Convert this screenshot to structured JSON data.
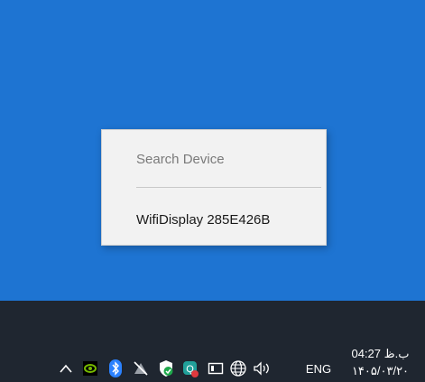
{
  "context_menu": {
    "items": [
      {
        "label": "Search Device",
        "enabled": false
      },
      {
        "label": "WifiDisplay 285E426B",
        "enabled": true
      }
    ]
  },
  "taskbar": {
    "tray_icons": [
      "show-hidden-icons-chevron-icon",
      "nvidia-icon",
      "bluetooth-icon",
      "network-disabled-icon",
      "windows-security-icon",
      "app-notification-icon",
      "display-icon",
      "globe-network-icon",
      "speaker-volume-icon"
    ],
    "language": "ENG",
    "time": "04:27 ب.ظ",
    "date": "۱۴۰۵/۰۳/۲۰"
  },
  "colors": {
    "desktop": "#1e74d2",
    "taskbar": "#1f2630",
    "menu_bg": "#f2f2f2",
    "nvidia_green": "#76b900",
    "bluetooth_blue": "#2b82ff",
    "security_green": "#1ea84b",
    "app_teal": "#21a09a",
    "app_red": "#e0393e"
  }
}
